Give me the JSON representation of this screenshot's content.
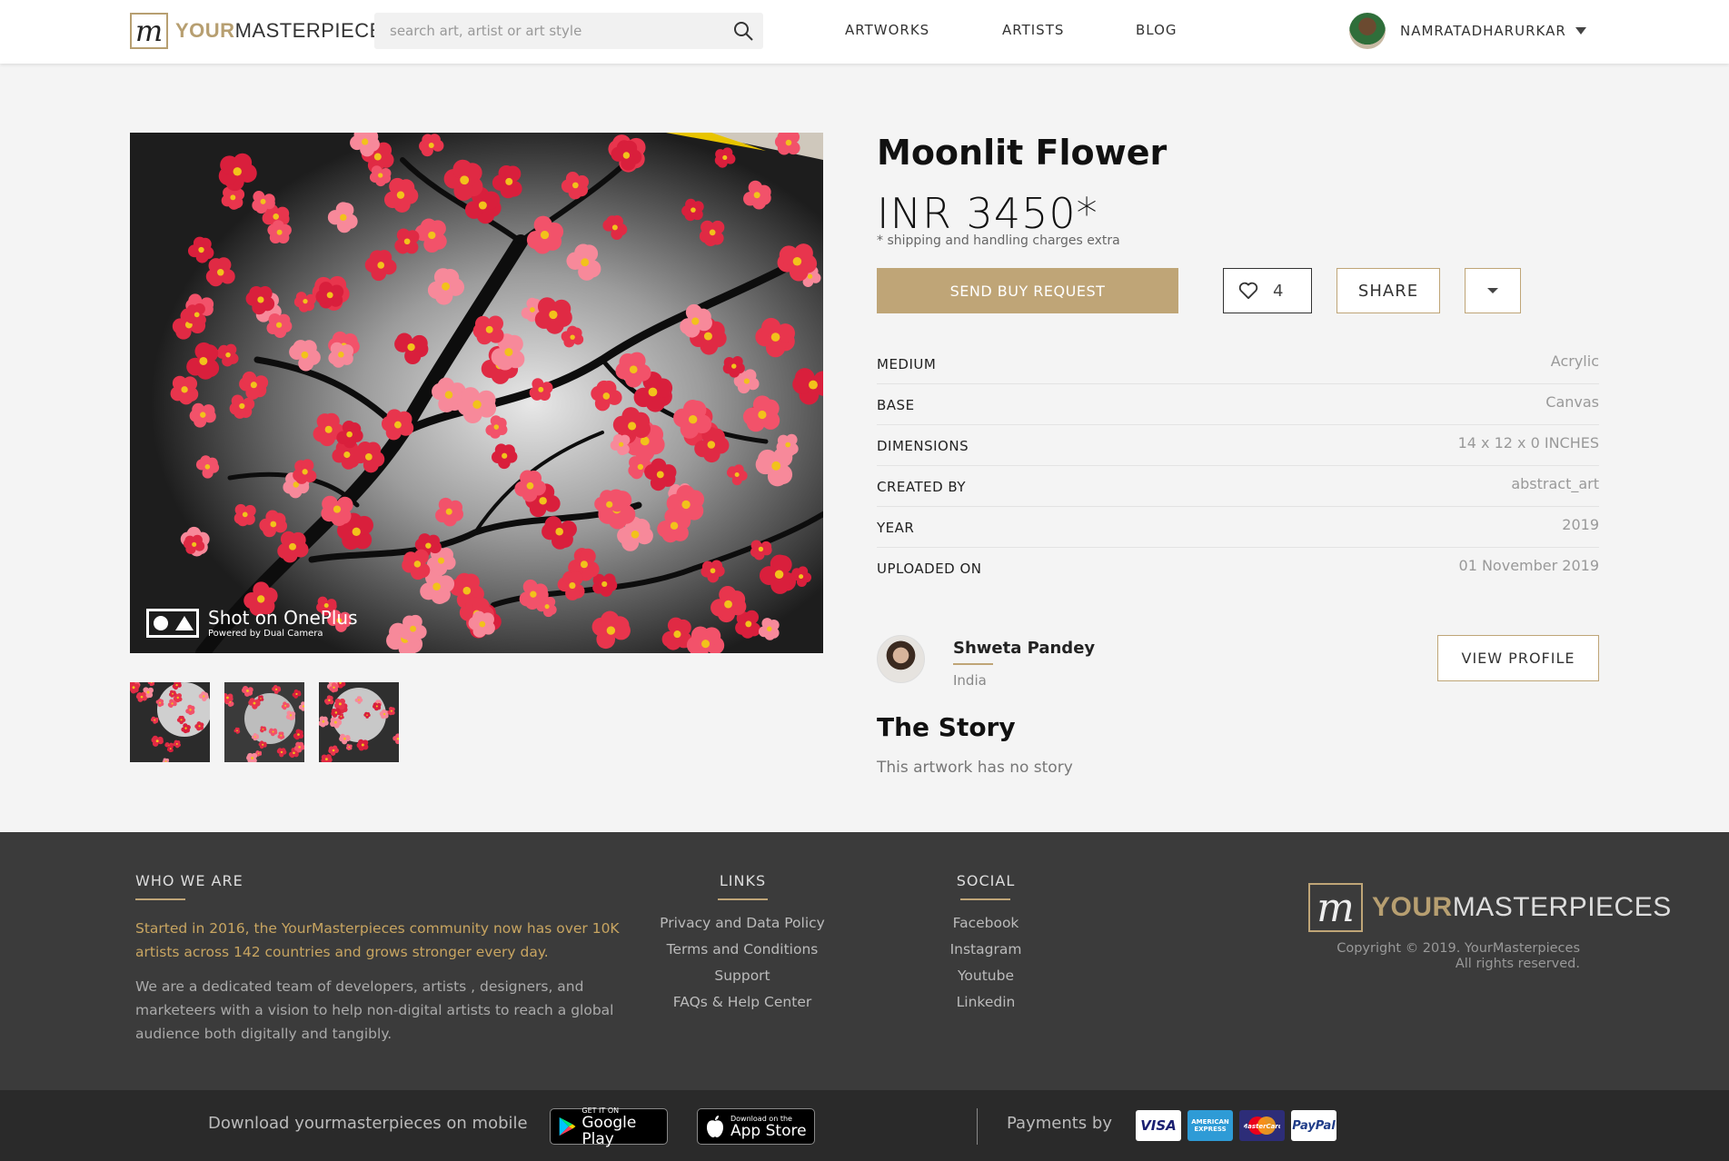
{
  "header": {
    "logo_word_your": "YOUR",
    "logo_word_masterpieces": "MASTERPIECES",
    "search_placeholder": "search art, artist or art style",
    "nav": [
      "ARTWORKS",
      "ARTISTS",
      "BLOG"
    ],
    "username": "NAMRATADHARURKAR"
  },
  "artwork": {
    "watermark_title": "Shot on OnePlus",
    "watermark_sub": "Powered by Dual Camera",
    "title": "Moonlit Flower",
    "price": "INR 3450*",
    "price_note": "* shipping and handling charges extra",
    "buy_label": "SEND BUY REQUEST",
    "likes": "4",
    "share_label": "SHARE",
    "specs": [
      {
        "label": "MEDIUM",
        "value": "Acrylic"
      },
      {
        "label": "BASE",
        "value": "Canvas"
      },
      {
        "label": "DIMENSIONS",
        "value": "14 x 12 x 0 INCHES"
      },
      {
        "label": "CREATED BY",
        "value": "abstract_art"
      },
      {
        "label": "YEAR",
        "value": "2019"
      },
      {
        "label": "UPLOADED ON",
        "value": "01 November 2019"
      }
    ]
  },
  "artist": {
    "name": "Shweta Pandey",
    "country": "India",
    "view_profile_label": "VIEW PROFILE"
  },
  "story": {
    "title": "The Story",
    "text": "This artwork has no story"
  },
  "footer": {
    "who_title": "WHO WE ARE",
    "who_gold": "Started in 2016, the YourMasterpieces community now has over 10K artists across 142 countries and grows stronger every day.",
    "who_text": "We are a dedicated team of developers, artists , designers, and marketeers with a vision to help non-digital artists to reach a global audience both digitally and tangibly.",
    "links_title": "LINKS",
    "links": [
      "Privacy and Data Policy",
      "Terms and Conditions",
      "Support",
      "FAQs & Help Center"
    ],
    "social_title": "SOCIAL",
    "social": [
      "Facebook",
      "Instagram",
      "Youtube",
      "Linkedin"
    ],
    "copyright_line1": "Copyright © 2019. YourMasterpieces",
    "copyright_line2": "All rights reserved.",
    "download_text": "Download yourmasterpieces on mobile",
    "google_small": "GET IT ON",
    "google_big": "Google Play",
    "apple_small": "Download on the",
    "apple_big": "App Store",
    "payments_text": "Payments by",
    "cards": [
      "VISA",
      "AMERICAN EXPRESS",
      "MasterCard",
      "PayPal"
    ]
  },
  "colors": {
    "accent_gold": "#bfa577",
    "footer_bg": "#3b3b3b",
    "bottom_bar_bg": "#2a2a2a"
  }
}
